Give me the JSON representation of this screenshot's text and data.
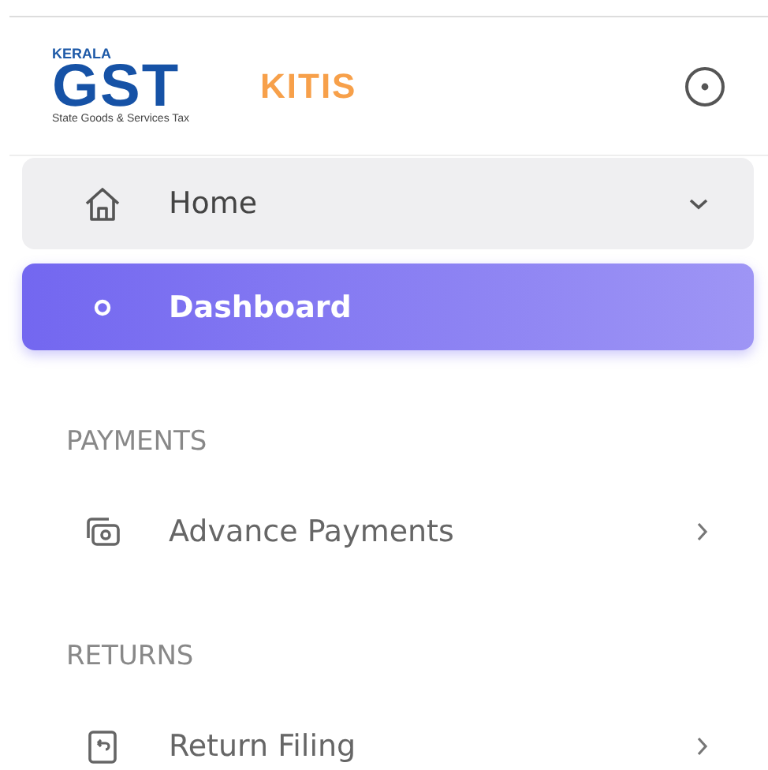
{
  "brand": {
    "logo_top": "KERALA",
    "logo_main": "GST",
    "logo_sub": "State Goods & Services Tax",
    "app_name": "KITIS"
  },
  "menu": [
    {
      "kind": "item",
      "label": "Home",
      "expanded": true,
      "children": [
        {
          "label": "Dashboard",
          "selected": true
        }
      ]
    },
    {
      "kind": "section",
      "label": "PAYMENTS"
    },
    {
      "kind": "item",
      "label": "Advance Payments",
      "expanded": false
    },
    {
      "kind": "section",
      "label": "RETURNS"
    },
    {
      "kind": "item",
      "label": "Return Filing",
      "expanded": false
    }
  ]
}
